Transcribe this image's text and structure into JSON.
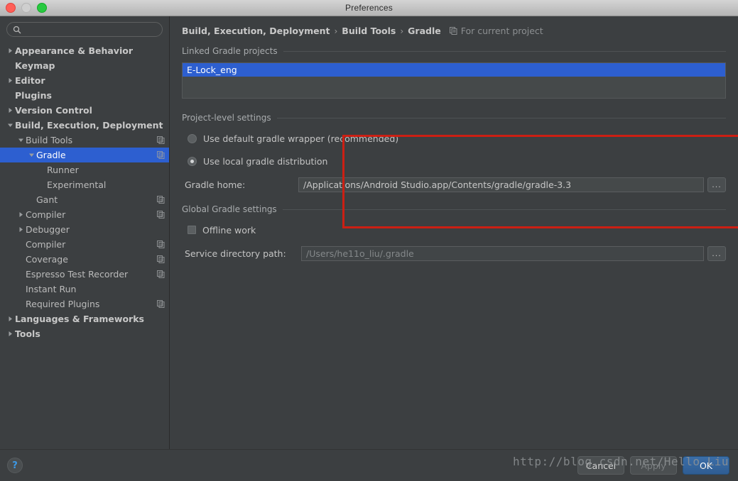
{
  "window": {
    "title": "Preferences",
    "traffic_lights": [
      "close-button",
      "minimize-button",
      "maximize-button"
    ]
  },
  "sidebar": {
    "search": {
      "value": "",
      "placeholder": ""
    },
    "items": [
      {
        "label": "Appearance & Behavior",
        "indent": 0,
        "twisty": "collapsed",
        "bold": true,
        "badge": false,
        "selected": false
      },
      {
        "label": "Keymap",
        "indent": 0,
        "twisty": "none",
        "bold": true,
        "badge": false,
        "selected": false
      },
      {
        "label": "Editor",
        "indent": 0,
        "twisty": "collapsed",
        "bold": true,
        "badge": false,
        "selected": false
      },
      {
        "label": "Plugins",
        "indent": 0,
        "twisty": "none",
        "bold": true,
        "badge": false,
        "selected": false
      },
      {
        "label": "Version Control",
        "indent": 0,
        "twisty": "collapsed",
        "bold": true,
        "badge": false,
        "selected": false
      },
      {
        "label": "Build, Execution, Deployment",
        "indent": 0,
        "twisty": "expanded",
        "bold": true,
        "badge": false,
        "selected": false
      },
      {
        "label": "Build Tools",
        "indent": 1,
        "twisty": "expanded",
        "bold": false,
        "badge": true,
        "selected": false
      },
      {
        "label": "Gradle",
        "indent": 2,
        "twisty": "expanded",
        "bold": false,
        "badge": true,
        "selected": true
      },
      {
        "label": "Runner",
        "indent": 3,
        "twisty": "none",
        "bold": false,
        "badge": false,
        "selected": false
      },
      {
        "label": "Experimental",
        "indent": 3,
        "twisty": "none",
        "bold": false,
        "badge": false,
        "selected": false
      },
      {
        "label": "Gant",
        "indent": 2,
        "twisty": "none",
        "bold": false,
        "badge": true,
        "selected": false
      },
      {
        "label": "Compiler",
        "indent": 1,
        "twisty": "collapsed",
        "bold": false,
        "badge": true,
        "selected": false
      },
      {
        "label": "Debugger",
        "indent": 1,
        "twisty": "collapsed",
        "bold": false,
        "badge": false,
        "selected": false
      },
      {
        "label": "Compiler",
        "indent": 1,
        "twisty": "none",
        "bold": false,
        "badge": true,
        "selected": false
      },
      {
        "label": "Coverage",
        "indent": 1,
        "twisty": "none",
        "bold": false,
        "badge": true,
        "selected": false
      },
      {
        "label": "Espresso Test Recorder",
        "indent": 1,
        "twisty": "none",
        "bold": false,
        "badge": true,
        "selected": false
      },
      {
        "label": "Instant Run",
        "indent": 1,
        "twisty": "none",
        "bold": false,
        "badge": false,
        "selected": false
      },
      {
        "label": "Required Plugins",
        "indent": 1,
        "twisty": "none",
        "bold": false,
        "badge": true,
        "selected": false
      },
      {
        "label": "Languages & Frameworks",
        "indent": 0,
        "twisty": "collapsed",
        "bold": true,
        "badge": false,
        "selected": false
      },
      {
        "label": "Tools",
        "indent": 0,
        "twisty": "collapsed",
        "bold": true,
        "badge": false,
        "selected": false
      }
    ]
  },
  "main": {
    "breadcrumb": {
      "crumb1": "Build, Execution, Deployment",
      "crumb2": "Build Tools",
      "crumb3": "Gradle",
      "separator": "›",
      "scope_text": "For current project"
    },
    "linked_projects": {
      "title": "Linked Gradle projects",
      "items": [
        {
          "label": "E-Lock_eng",
          "selected": true
        }
      ]
    },
    "project_settings": {
      "title": "Project-level settings",
      "options": [
        {
          "label": "Use default gradle wrapper (recommended)",
          "selected": false
        },
        {
          "label": "Use local gradle distribution",
          "selected": true
        }
      ],
      "gradle_home": {
        "label": "Gradle home:",
        "value": "/Applications/Android Studio.app/Contents/gradle/gradle-3.3",
        "browse_label": "..."
      }
    },
    "global_settings": {
      "title": "Global Gradle settings",
      "offline_work": {
        "label": "Offline work",
        "checked": false
      },
      "service_directory": {
        "label": "Service directory path:",
        "value": "/Users/he11o_liu/.gradle",
        "browse_label": "..."
      }
    }
  },
  "footer": {
    "help_label": "?",
    "cancel_label": "Cancel",
    "apply_label": "Apply",
    "ok_label": "OK"
  },
  "watermark": {
    "text": "http://blog.csdn.net/Hello_Liu"
  },
  "colors": {
    "background": "#3c3f41",
    "selection_blue": "#2d5fd0",
    "annotation_red": "#cc1f13",
    "default_button_blue": "#3b6ea8",
    "help_blue": "#3c9ae8"
  }
}
